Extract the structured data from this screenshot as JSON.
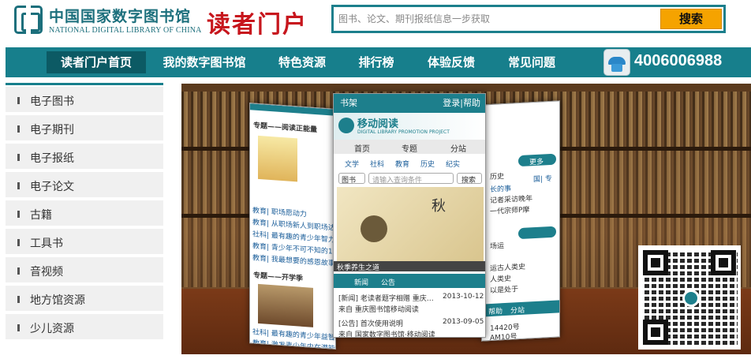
{
  "header": {
    "logo_cn": "中国国家数字图书馆",
    "logo_en": "NATIONAL DIGITAL LIBRARY OF CHINA",
    "portal_title": "读者门户",
    "logo_icon": "library-logo-icon"
  },
  "search": {
    "placeholder": "图书、论文、期刊报纸信息一步获取",
    "button_label": "搜索"
  },
  "nav": {
    "items": [
      {
        "label": "读者门户首页",
        "active": true
      },
      {
        "label": "我的数字图书馆",
        "active": false
      },
      {
        "label": "特色资源",
        "active": false
      },
      {
        "label": "排行榜",
        "active": false
      },
      {
        "label": "体验反馈",
        "active": false
      },
      {
        "label": "常见问题",
        "active": false
      }
    ],
    "phone_icon": "telephone-icon",
    "phone_number": "4006006988"
  },
  "sidebar": {
    "items": [
      {
        "label": "电子图书"
      },
      {
        "label": "电子期刊"
      },
      {
        "label": "电子报纸"
      },
      {
        "label": "电子论文"
      },
      {
        "label": "古籍"
      },
      {
        "label": "工具书"
      },
      {
        "label": "音视频"
      },
      {
        "label": "地方馆资源"
      },
      {
        "label": "少儿资源"
      }
    ]
  },
  "banner": {
    "center_phone": {
      "bar_left": "书架",
      "bar_right": "登录|帮助",
      "app_title": "移动阅读",
      "app_subtitle": "DIGITAL LIBRARY PROMOTION PROJECT",
      "tabs": [
        "首页",
        "专题",
        "分站"
      ],
      "subtabs": [
        "文学",
        "社科",
        "教育",
        "历史",
        "纪实"
      ],
      "search_type": "图书",
      "search_placeholder": "请输入查询条件",
      "search_button": "搜索",
      "feature_caption": "秋季养生之道",
      "news_tabs": [
        "新闻",
        "公告"
      ],
      "news": [
        {
          "title": "[新闻] 老读者题字相赠 重庆…",
          "date": "2013-10-12",
          "sub": "来自 重庆图书馆移动阅读"
        },
        {
          "title": "[公告] 首次使用说明",
          "date": "2013-09-05",
          "sub": "来自 国家数字图书馆·移动阅读"
        }
      ]
    },
    "left_phone": {
      "topic1": "专题——阅读正能量",
      "lines": [
        "教育| 职场愿动力",
        "教育| 从职场新人到职场达人",
        "社科| 最有趣的青少年智力题",
        "教育| 青少年不可不知的1000",
        "教育| 我最想要的感恩故事全"
      ],
      "topic2": "专题——开学季",
      "lines2": [
        "社科| 最有趣的青少年益智",
        "教育| 激发青少年内在潜能"
      ]
    },
    "right_phone": {
      "more": "更多",
      "lines": [
        "历史",
        "国| 专",
        "长的事",
        "记者采访晚年",
        "一代宗师P摩",
        "场运",
        "运古人类史",
        "人类史",
        "以是处于"
      ],
      "bottom": [
        "帮助",
        "分站"
      ],
      "codes": [
        "14420号",
        "AM10号"
      ]
    }
  }
}
